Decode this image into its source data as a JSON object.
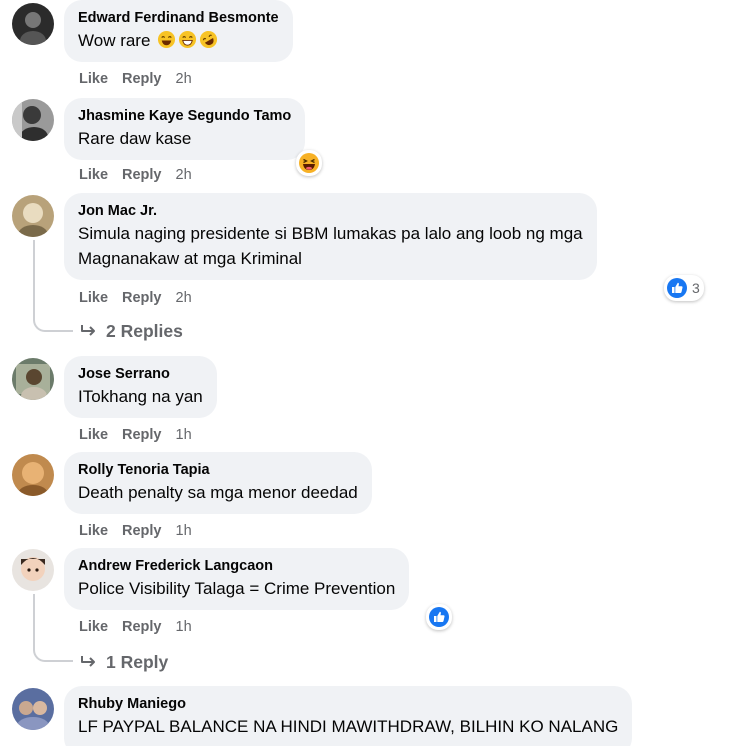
{
  "comments": [
    {
      "author": "Edward Ferdinand Besmonte",
      "text": "Wow rare",
      "emoji_icons": [
        "laughing-emoji-icon",
        "grinning-emoji-icon",
        "rofl-emoji-icon"
      ],
      "like": "Like",
      "reply": "Reply",
      "time": "2h"
    },
    {
      "author": "Jhasmine Kaye Segundo Tamo",
      "text": "Rare daw kase",
      "reaction_icon": "haha-reaction-icon",
      "like": "Like",
      "reply": "Reply",
      "time": "2h"
    },
    {
      "author": "Jon Mac Jr.",
      "text_lines": [
        "Simula naging presidente si BBM lumakas pa lalo ang loob ng mga",
        "Magnanakaw at mga Kriminal"
      ],
      "reaction_icon": "like-reaction-icon",
      "reaction_count": "3",
      "like": "Like",
      "reply": "Reply",
      "time": "2h",
      "replies_label": "2 Replies"
    },
    {
      "author": "Jose Serrano",
      "text": "ITokhang na yan",
      "like": "Like",
      "reply": "Reply",
      "time": "1h"
    },
    {
      "author": "Rolly Tenoria Tapia",
      "text": "Death penalty sa mga menor deedad",
      "like": "Like",
      "reply": "Reply",
      "time": "1h"
    },
    {
      "author": "Andrew Frederick Langcaon",
      "text": "Police Visibility Talaga = Crime Prevention",
      "reaction_icon": "like-reaction-icon",
      "like": "Like",
      "reply": "Reply",
      "time": "1h",
      "replies_label": "1 Reply"
    },
    {
      "author": "Rhuby Maniego",
      "text": "LF PAYPAL BALANCE NA HINDI MAWITHDRAW, BILHIN KO NALANG"
    }
  ],
  "colors": {
    "bubble": "#f0f2f5",
    "secondary_text": "#65676b",
    "like_blue": "#1877f2",
    "haha_yellow": "#f7b125"
  }
}
